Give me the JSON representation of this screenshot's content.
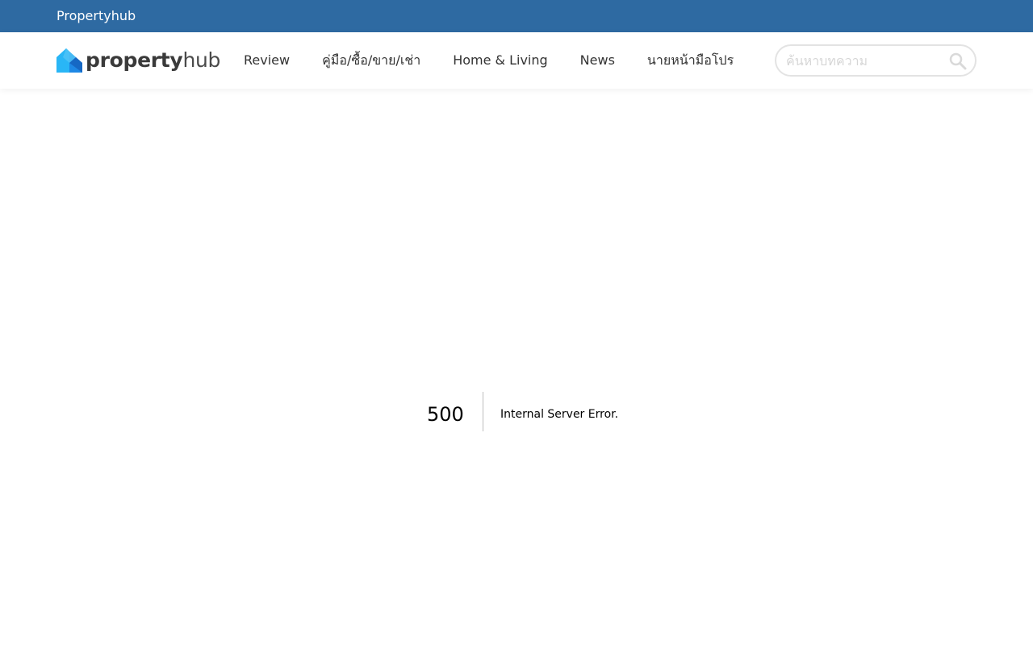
{
  "topbar": {
    "brand_link": "Propertyhub",
    "bg_color": "#2e6aa2"
  },
  "header": {
    "logo": {
      "text_bold": "property",
      "text_light": "hub",
      "icon": "propertyhub-logo-icon"
    },
    "nav": [
      {
        "label": "Review"
      },
      {
        "label": "คู่มือ/ซื้อ/ขาย/เช่า"
      },
      {
        "label": "Home & Living"
      },
      {
        "label": "News"
      },
      {
        "label": "นายหน้ามือโปร"
      }
    ],
    "search": {
      "placeholder": "ค้นหาบทความ",
      "icon": "search-icon"
    }
  },
  "error": {
    "code": "500",
    "message": "Internal Server Error."
  }
}
